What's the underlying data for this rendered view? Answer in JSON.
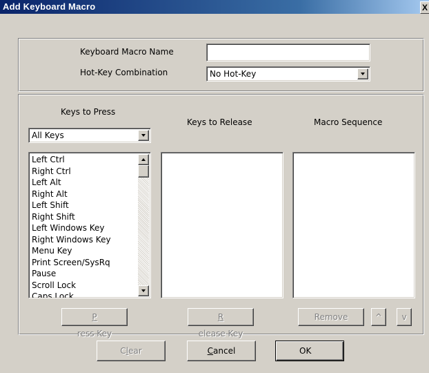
{
  "window": {
    "title": "Add Keyboard Macro",
    "close_glyph": "X"
  },
  "macro": {
    "name_label": "Keyboard Macro Name",
    "name_value": "",
    "hotkey_label": "Hot-Key Combination",
    "hotkey_value": "No Hot-Key"
  },
  "keys_to_press": {
    "header": "Keys to Press",
    "filter_value": "All Keys",
    "items": [
      "Left Ctrl",
      "Right Ctrl",
      "Left Alt",
      "Right Alt",
      "Left Shift",
      "Right Shift",
      "Left Windows Key",
      "Right Windows Key",
      "Menu Key",
      "Print Screen/SysRq",
      "Pause",
      "Scroll Lock",
      "Caps Lock"
    ],
    "button_accel": "P",
    "button_rest": "ress Key"
  },
  "keys_to_release": {
    "header": "Keys to Release",
    "items": [],
    "button_accel": "R",
    "button_rest": "elease Key"
  },
  "macro_sequence": {
    "header": "Macro Sequence",
    "items": [],
    "remove_label": "Remove",
    "up_label": "^",
    "down_label": "v"
  },
  "footer": {
    "clear_pre": "C",
    "clear_accel": "l",
    "clear_rest": "ear",
    "cancel_accel": "C",
    "cancel_rest": "ancel",
    "ok_label": "OK"
  },
  "colors": {
    "face": "#d4d0c8",
    "title_start": "#0a246a",
    "title_end": "#a6caf0",
    "disabled_text": "#808080"
  }
}
